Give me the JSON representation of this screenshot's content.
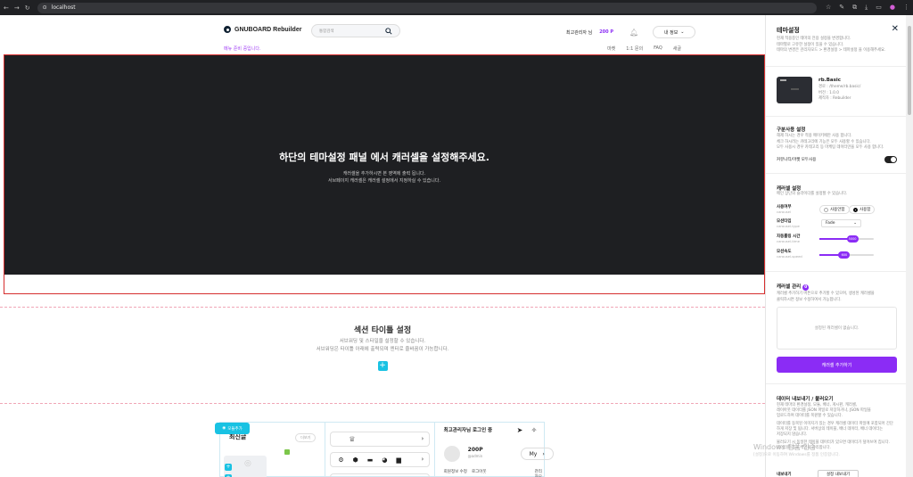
{
  "browser": {
    "url": "localhost",
    "nav_icons": [
      "back-icon",
      "forward-icon",
      "reload-icon"
    ],
    "action_icons": [
      "star-icon",
      "pen-icon",
      "extension-icon",
      "download-icon",
      "tab-icon",
      "profile-icon",
      "menu-icon"
    ]
  },
  "header": {
    "logo_text": "GNUBOARD Rebuilder",
    "search_placeholder": "통합검색",
    "user_greeting": "최고관리자 님",
    "points": "200 P",
    "my_info": "내 정보",
    "notice": "메뉴 준비 중입니다.",
    "top_links": [
      "마켓",
      "1:1 문의",
      "FAQ",
      "새글"
    ]
  },
  "banner": {
    "title": "하단의 테마설정 패널 에서 캐러셀을 설정해주세요.",
    "line1": "캐러셀을 추가하시면 본 영역에 출력 됩니다.",
    "line2": "서브페이지 캐러셀은 캐러셀 설정에서 지정하실 수 있습니다."
  },
  "section": {
    "title": "섹션 타이틀 설정",
    "line1": "서브워딩 및 스타일을 설정할 수 있습니다.",
    "line2": "서브워딩은 타이틀 아래에 출력되며 엔터로 줄바꿈이 가능합니다.",
    "add": "+"
  },
  "widgets": {
    "latest_title": "최신글",
    "more": "더보기",
    "cover_add": "모듈추가",
    "admin_login": "최고관리자님 로그인 중",
    "user_points": "200P",
    "user_id": "@admin",
    "my_button": "My",
    "links": [
      "회원정보 수정",
      "로그아웃"
    ],
    "admin_mode": "관리자모드"
  },
  "panel": {
    "title": "테마설정",
    "desc": [
      "현재 적용중인 테마의 전용 설정을 변경합니다.",
      "테마별로 고유한 설정이 있을 수 있습니다.",
      "테마의 변경은 관리자모드 > 환경설정 > 테마설정 을 이용해주세요."
    ],
    "theme_name": "rb.Basic",
    "theme_meta": [
      "경로 : /theme/rb.basic/",
      "버전 : 1.0.0",
      "제작자 : Rebuilder"
    ],
    "section_use_title": "구분사용 설정",
    "section_use_desc": [
      "해제 하시는 경우 적용 메이키에만 사용 합니다.",
      "체크 하시려는 카테고리에 기능은 모두 사용할 수 있습니다.",
      "모두 사용시 경우 카테고리 등 마케팅 데이터만을 모두 사용 합니다."
    ],
    "community_label": "커뮤니티/마켓 모두사용",
    "carousel_title": "캐러셀 설정",
    "carousel_desc": "메인 상단의 슬라이더를 설정할 수 있습니다.",
    "use_label": "사용여부",
    "use_key": "carousel",
    "use_options": [
      "사용안함",
      "사용함"
    ],
    "effect_label": "모션타입",
    "effect_key": "carousel-type",
    "effect_value": "Fade",
    "time_label": "자동롤링 시간",
    "time_key": "carousel-time",
    "time_value": "5000",
    "time_fraction": 0.6,
    "speed_label": "모션속도",
    "speed_key": "carousel-speed",
    "speed_value": "600",
    "speed_fraction": 0.45,
    "manage_title": "캐러셀 관리",
    "manage_badge": "0",
    "manage_desc": [
      "캐러셀 추가하기 버튼으로 추가할 수 있으며, 생성된 캐러셀을",
      "클릭하시면 정보 수정하여서 가능합니다."
    ],
    "empty_text": "설정된 캐러셀이 없습니다.",
    "add_button": "캐러셀 추가하기",
    "export_title": "데이터 내보내기 / 불러오기",
    "export_desc": [
      "현재 테마의 환경설정, 모듈, 배너, 게시판, 캐러셀,",
      "레이아웃 데이터를 JSON 파일로 저장하거나, JSON 파일을",
      "업로드하여 데이터를 복원할 수 있습니다.",
      "데이터를 동복된 이미지가 있는 경우 캐러셀 데이터 파일에 포함되어 간단",
      "하게 저장 및 됩니다. 서버상의 테이블, 배너 데이터, 배너 데이터는",
      "저장되지 않습니다.",
      "불러오기 시 동일한 테이블 데이터가 있으면 데이터가 덮어쓰여 집니다.",
      "데이터를 통해 백업을 관리합니다."
    ],
    "export_label": "내보내기",
    "export_button": "설정 내보내기"
  },
  "os_watermark": {
    "title": "Windows 정품 인증",
    "sub": "[설정]으로 이동하여 Windows를 정품 인증합니다."
  }
}
